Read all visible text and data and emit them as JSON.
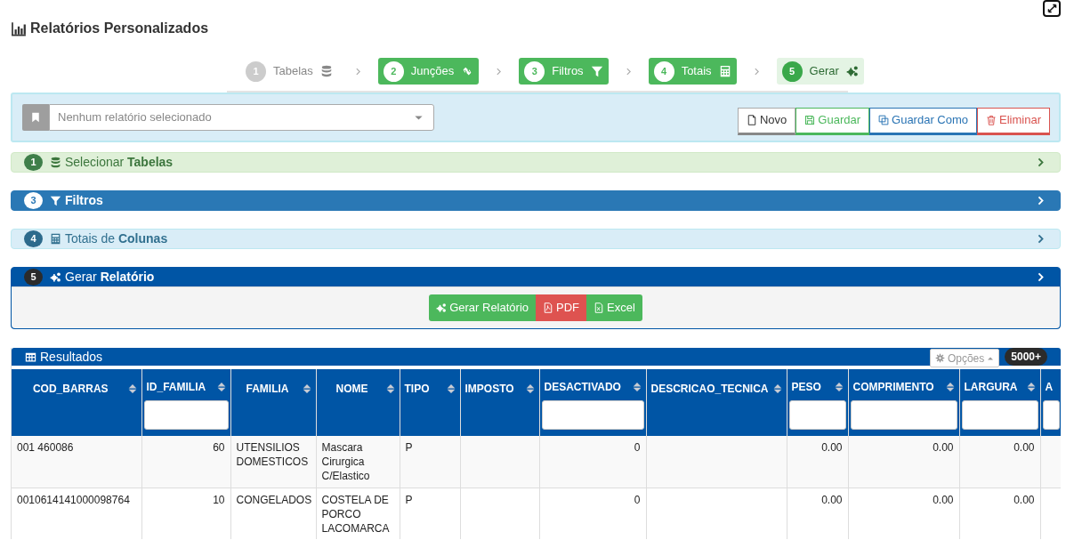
{
  "page": {
    "title": "Relatórios Personalizados"
  },
  "steps": [
    {
      "number": "1",
      "label": "Tabelas",
      "kind": "inactive"
    },
    {
      "number": "2",
      "label": "Junções",
      "kind": "done"
    },
    {
      "number": "3",
      "label": "Filtros",
      "kind": "done"
    },
    {
      "number": "4",
      "label": "Totais",
      "kind": "done"
    },
    {
      "number": "5",
      "label": "Gerar",
      "kind": "current"
    }
  ],
  "report_picker": {
    "placeholder": "Nenhum relatório selecionado"
  },
  "toolbar_buttons": [
    {
      "label": "Novo"
    },
    {
      "label": "Guardar"
    },
    {
      "label": "Guardar Como"
    },
    {
      "label": "Eliminar"
    }
  ],
  "panels": [
    {
      "number": "1",
      "title": "Selecionar",
      "title_strong": "Tabelas",
      "expanded": false
    },
    {
      "number": "3",
      "title_strong": "Filtros",
      "expanded": false
    },
    {
      "number": "4",
      "title": "Totais de",
      "title_strong": "Colunas",
      "expanded": false
    },
    {
      "number": "5",
      "title": "Gerar",
      "title_strong": "Relatório",
      "expanded": true,
      "buttons": [
        {
          "label": "Gerar Relatório"
        },
        {
          "label": "PDF"
        },
        {
          "label": "Excel"
        }
      ]
    }
  ],
  "results": {
    "title": "Resultados",
    "options_button": "Opções",
    "count_badge": "5000+",
    "table": {
      "columns": [
        {
          "label": "COD_BARRAS",
          "filter": false
        },
        {
          "label": "ID_FAMILIA",
          "filter": true
        },
        {
          "label": "FAMILIA",
          "filter": false
        },
        {
          "label": "NOME",
          "filter": false
        },
        {
          "label": "TIPO",
          "filter": false
        },
        {
          "label": "IMPOSTO",
          "filter": false
        },
        {
          "label": "DESACTIVADO",
          "filter": true
        },
        {
          "label": "DESCRICAO_TECNICA",
          "filter": false
        },
        {
          "label": "PESO",
          "filter": true
        },
        {
          "label": "COMPRIMENTO",
          "filter": true
        },
        {
          "label": "LARGURA",
          "filter": true
        },
        {
          "label": "A",
          "filter": true
        }
      ],
      "rows": [
        [
          "001 460086",
          "60",
          "UTENSILIOS DOMESTICOS",
          "Mascara Cirurgica C/Elastico",
          "P",
          "",
          "0",
          "",
          "0.00",
          "0.00",
          "0.00",
          ""
        ],
        [
          "0010614141000098764",
          "10",
          "CONGELADOS",
          "COSTELA DE PORCO LACOMARCA",
          "P",
          "",
          "0",
          "",
          "0.00",
          "0.00",
          "0.00",
          ""
        ]
      ]
    }
  }
}
